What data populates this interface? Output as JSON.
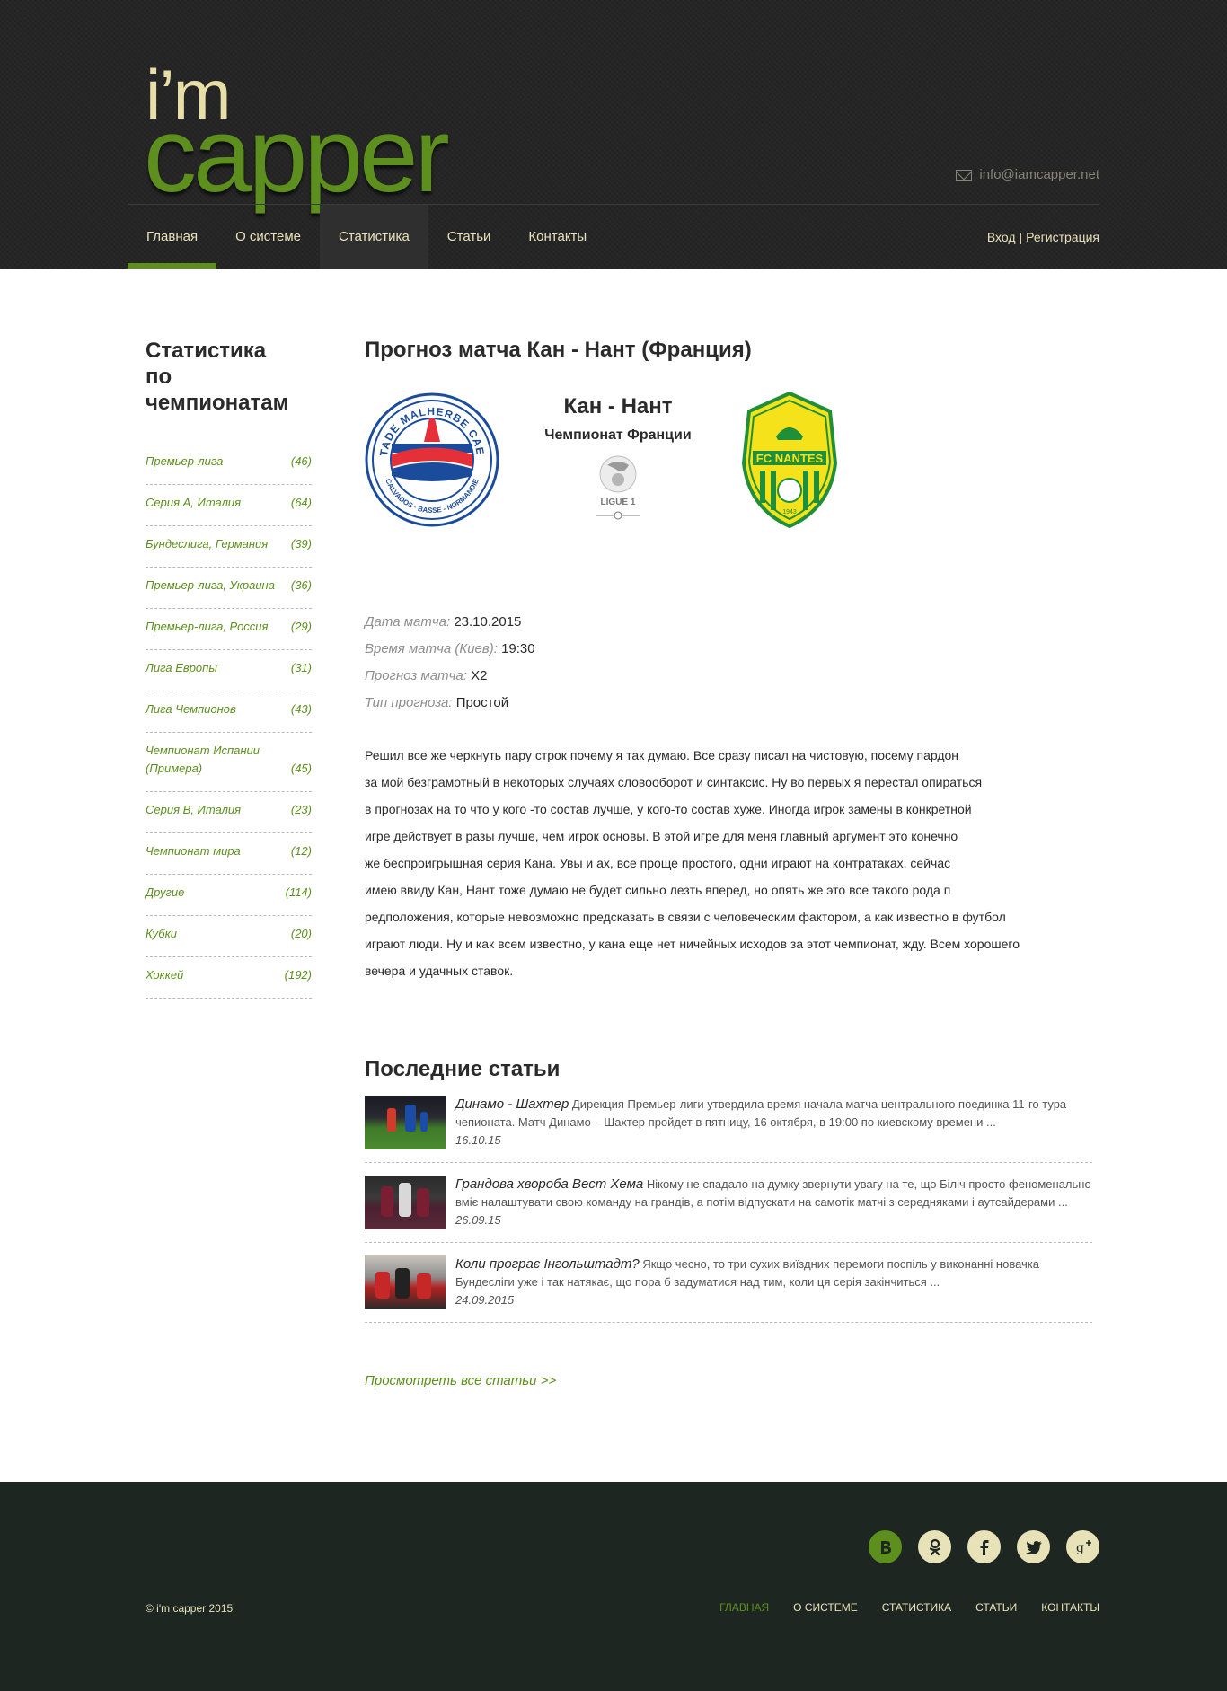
{
  "header": {
    "logo_top": "i’m",
    "logo_bottom": "capper",
    "email": "info@iamcapper.net",
    "nav": [
      {
        "label": "Главная"
      },
      {
        "label": "О системе"
      },
      {
        "label": "Статистика"
      },
      {
        "label": "Статьи"
      },
      {
        "label": "Контакты"
      }
    ],
    "login": "Вход",
    "separator": "|",
    "register": "Регистрация"
  },
  "sidebar": {
    "title_line1": "Статистика",
    "title_line2": "по чемпионатам",
    "items": [
      {
        "name": "Премьер-лига",
        "count": "(46)"
      },
      {
        "name": "Серия А, Италия",
        "count": "(64)"
      },
      {
        "name": "Бундеслига, Германия",
        "count": "(39)"
      },
      {
        "name": "Премьер-лига, Украина",
        "count": "(36)"
      },
      {
        "name": "Премьер-лига, Россия",
        "count": "(29)"
      },
      {
        "name": "Лига Европы",
        "count": "(31)"
      },
      {
        "name": "Лига Чемпионов",
        "count": "(43)"
      },
      {
        "name": "Чемпионат Испании (Примера)",
        "count": "(45)"
      },
      {
        "name": "Серия В, Италия",
        "count": "(23)"
      },
      {
        "name": "Чемпионат мира",
        "count": "(12)"
      },
      {
        "name": "Другие",
        "count": "(114)"
      },
      {
        "name": "Кубки",
        "count": "(20)"
      },
      {
        "name": "Хоккей",
        "count": "(192)"
      }
    ]
  },
  "main": {
    "title": "Прогноз матча Кан - Нант (Франция)",
    "match": {
      "title": "Кан - Нант",
      "league": "Чемпионат Франции",
      "home_logo_text": "STADE MALHERBE CAEN",
      "home_logo_sub": "CALVADOS · BASSE - NORMANDIE",
      "away_logo_text": "FC NANTES",
      "away_logo_year": "1943",
      "ligue_label": "LIGUE 1"
    },
    "details": [
      {
        "label": "Дата матча:",
        "value": "23.10.2015"
      },
      {
        "label": "Время матча (Киев):",
        "value": "19:30"
      },
      {
        "label": "Прогноз матча:",
        "value": "X2"
      },
      {
        "label": "Тип прогноза:",
        "value": "Простой"
      }
    ],
    "text_lines": [
      "Решил все же черкнуть пару строк почему я так думаю. Все сразу писал на чистовую, посему пардон",
      "за мой безграмотный в некоторых случаях словооборот и синтаксис. Ну во первых я перестал опираться",
      "в прогнозах на то что у кого -то состав лучше, у кого-то состав хуже. Иногда игрок замены в конкретной",
      "игре действует в разы лучше, чем игрок основы. В этой игре для меня главный аргумент это конечно",
      "же беспроигрышная серия Кана. Увы и ах, все проще простого, одни играют на контратаках, сейчас",
      "имею ввиду Кан, Нант тоже думаю не будет сильно лезть вперед, но опять же  это все такого рода п",
      "редположения, которые невозможно предсказать в связи с человеческим фактором, а как известно в футбол",
      "играют люди. Ну и как всем известно, у кана еще нет ничейных исходов за этот чемпионат, жду. Всем хорошего",
      "вечера и удачных ставок."
    ],
    "recent_title": "Последние статьи",
    "news": [
      {
        "title": "Динамо - Шахтер",
        "excerpt": "Дирекция Премьер-лиги утвердила время начала матча центрального поединка 11-го тура чепионата. Матч Динамо – Шахтер пройдет в пятницу, 16 октября, в 19:00 по киевскому времени ...",
        "date": "16.10.15"
      },
      {
        "title": "Грандова хвороба Вест Хема",
        "excerpt": "Нікому не спадало на думку звернути увагу на те, що Біліч просто феноменально вміє налаштувати свою команду на грандів, а потім відпускати на самотік матчі з середняками і аутсайдерами ...",
        "date": "26.09.15"
      },
      {
        "title": "Коли програє Інгольштадт?",
        "excerpt": "Якщо чесно, то три сухих виїздних перемоги поспіль у виконанні новачка Бундесліги уже і так натякає, що пора б задуматися над тим, коли ця серія закінчиться ...",
        "date": "24.09.2015"
      }
    ],
    "see_all": "Просмотреть все статьи >>"
  },
  "footer": {
    "copyright": "© i'm capper 2015",
    "nav": [
      "Главная",
      "О системе",
      "Статистика",
      "Статьи",
      "Контакты"
    ],
    "socials": [
      "vk-icon",
      "odnoklassniki-icon",
      "facebook-icon",
      "twitter-icon",
      "google-plus-icon"
    ]
  },
  "colors": {
    "accent": "#5d8f1e",
    "cream": "#e8e2b8",
    "header_bg": "#252525",
    "footer_bg": "#1e2621"
  }
}
